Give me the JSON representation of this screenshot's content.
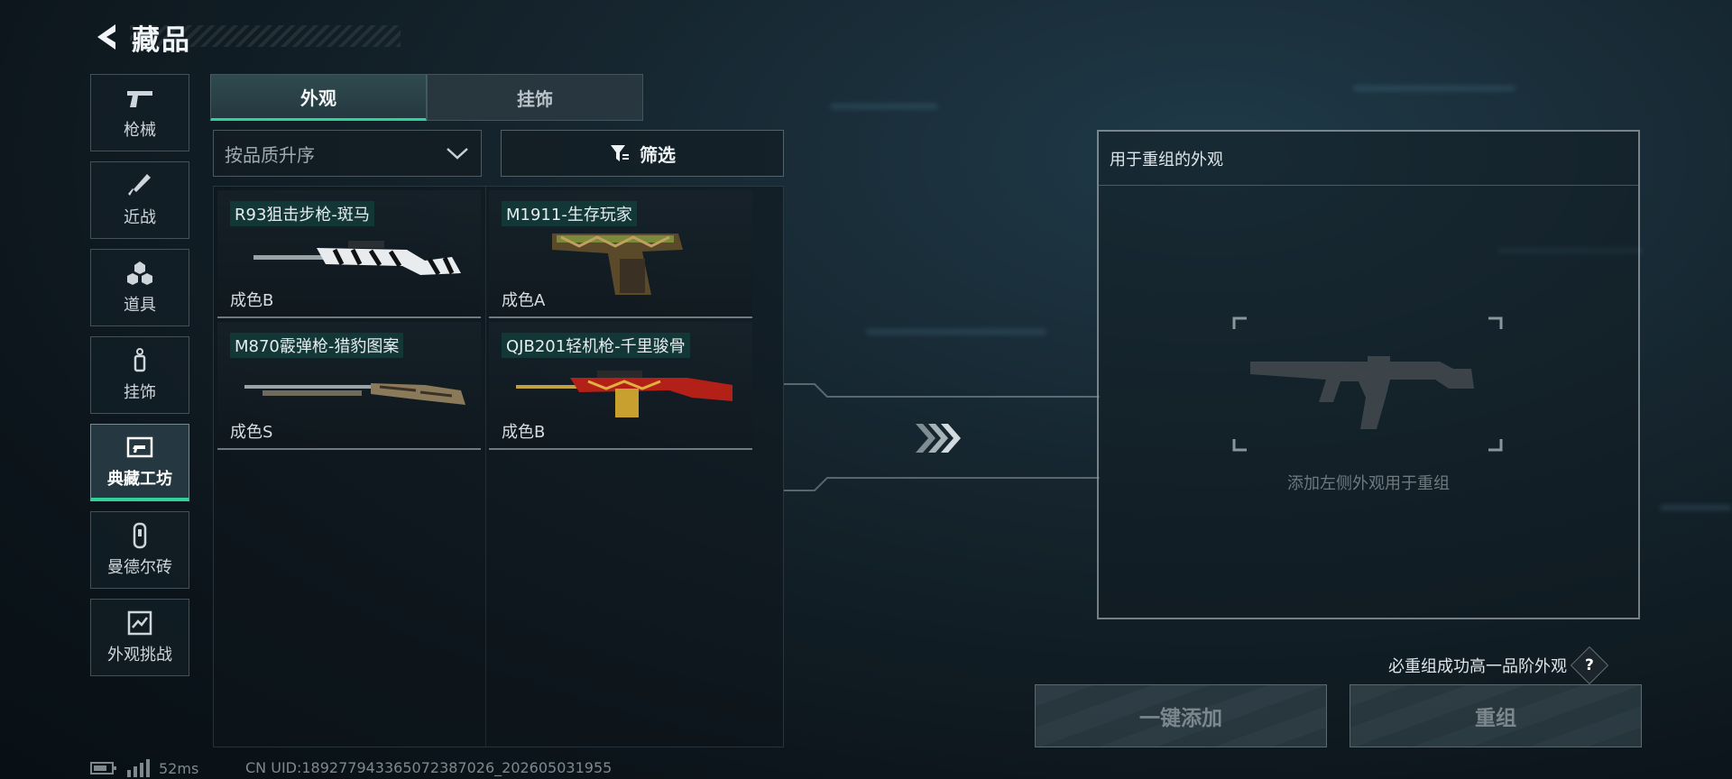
{
  "header": {
    "title": "藏品"
  },
  "nav": {
    "items": [
      {
        "label": "枪械",
        "icon": "pistol-icon"
      },
      {
        "label": "近战",
        "icon": "knife-icon"
      },
      {
        "label": "道具",
        "icon": "items-icon"
      },
      {
        "label": "挂饰",
        "icon": "charm-icon"
      },
      {
        "label": "典藏工坊",
        "icon": "workshop-icon"
      },
      {
        "label": "曼德尔砖",
        "icon": "brick-icon"
      },
      {
        "label": "外观挑战",
        "icon": "challenge-icon"
      }
    ],
    "active_index": 4
  },
  "tabs": [
    {
      "label": "外观"
    },
    {
      "label": "挂饰"
    }
  ],
  "sort": {
    "label": "按品质升序"
  },
  "filter": {
    "label": "筛选"
  },
  "cards": [
    {
      "name": "R93狙击步枪-斑马",
      "grade": "成色B"
    },
    {
      "name": "M1911-生存玩家",
      "grade": "成色A"
    },
    {
      "name": "M870霰弹枪-猎豹图案",
      "grade": "成色S"
    },
    {
      "name": "QJB201轻机枪-千里骏骨",
      "grade": "成色B"
    }
  ],
  "recombine": {
    "header": "用于重组的外观",
    "placeholder": "添加左侧外观用于重组",
    "note": "必重组成功高一品阶外观",
    "help": "?",
    "add_all_label": "一键添加",
    "recombine_label": "重组"
  },
  "status": {
    "ping": "52ms",
    "uid": "CN UID:18927794336507238702​6_202605031955"
  },
  "colors": {
    "accent": "#2fd39a",
    "background": "#0c151b"
  }
}
